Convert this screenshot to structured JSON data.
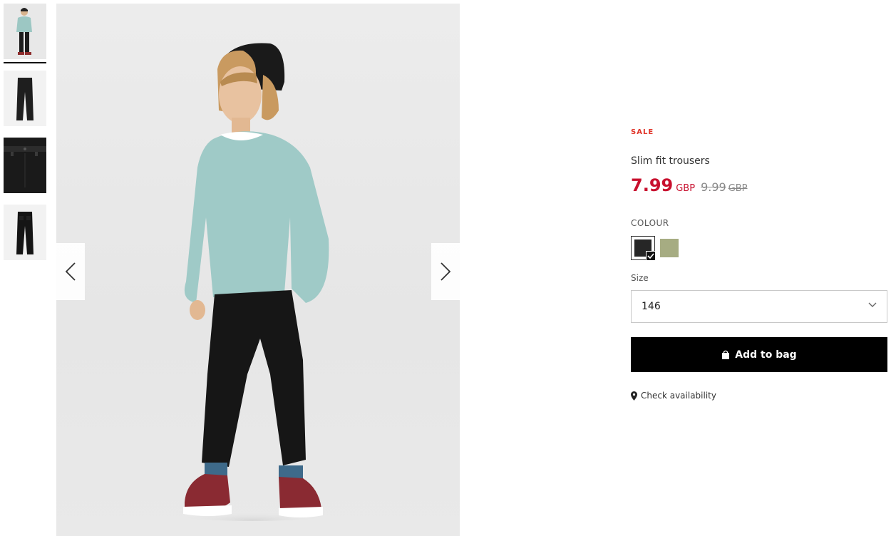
{
  "gallery": {
    "thumbnails": [
      {
        "name": "model-front"
      },
      {
        "name": "trousers-front"
      },
      {
        "name": "trousers-waist-detail"
      },
      {
        "name": "trousers-back"
      }
    ],
    "prev_icon": "chevron-left-icon",
    "next_icon": "chevron-right-icon"
  },
  "product": {
    "badge": "SALE",
    "title": "Slim fit trousers",
    "price_current": "7.99",
    "price_current_currency": "GBP",
    "price_old": "9.99",
    "price_old_currency": "GBP",
    "colour_label": "COLOUR",
    "colours": [
      {
        "name": "black",
        "hex": "#262626",
        "selected": true
      },
      {
        "name": "khaki",
        "hex": "#a6ac82",
        "selected": false
      }
    ],
    "size_label": "Size",
    "size_value": "146",
    "add_to_bag": "Add to bag",
    "check_availability": "Check availability"
  },
  "colors": {
    "sale_red": "#e0362b",
    "price_red": "#c8102e",
    "button_black": "#000000"
  }
}
